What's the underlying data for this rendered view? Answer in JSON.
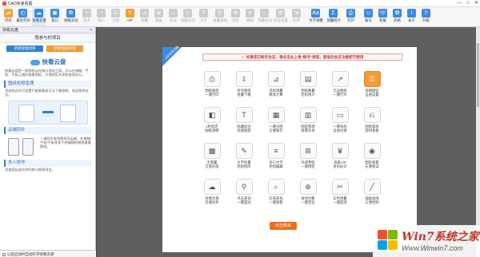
{
  "window": {
    "title": "CAD快速看图",
    "controls": [
      "—",
      "□",
      "✕"
    ]
  },
  "toolbar": {
    "tools": [
      {
        "label": "打开",
        "icon": "open-folder-icon",
        "color": "#e9a23b",
        "glyph": "📂",
        "state": "normal"
      },
      {
        "label": "最近打开",
        "icon": "recent-files-icon",
        "color": "#3c8be0",
        "glyph": "◴",
        "state": "normal"
      },
      {
        "label": "快看云盘",
        "icon": "cloud-icon",
        "color": "#3c8be0",
        "glyph": "☁",
        "state": "active"
      },
      {
        "label": "窗口",
        "icon": "window-icon",
        "color": "#3c8be0",
        "glyph": "▣",
        "state": "normal"
      },
      {
        "label": "图纸对比",
        "icon": "compare-icon",
        "color": "#3c8be0",
        "glyph": "⧉",
        "state": "normal"
      },
      {
        "label": "放大",
        "icon": "zoom-in-icon",
        "color": "#999",
        "glyph": "+",
        "state": "disabled"
      },
      {
        "label": "缩小",
        "icon": "zoom-out-icon",
        "color": "#999",
        "glyph": "−",
        "state": "disabled"
      },
      {
        "label": "全图",
        "icon": "fit-icon",
        "color": "#999",
        "glyph": "⊡",
        "state": "disabled"
      },
      {
        "label": "VIP",
        "icon": "vip-icon",
        "color": "#f0a030",
        "glyph": "V",
        "state": "normal"
      },
      {
        "label": "测量",
        "icon": "measure-icon",
        "color": "#999",
        "glyph": "⊿",
        "state": "disabled"
      },
      {
        "label": "图层",
        "icon": "layer-icon",
        "color": "#999",
        "glyph": "≣",
        "state": "disabled"
      },
      {
        "label": "标注",
        "icon": "dimension-icon",
        "color": "#999",
        "glyph": "↔",
        "state": "disabled"
      },
      {
        "label": "图纸识别",
        "icon": "recognize-icon",
        "color": "#999",
        "glyph": "⌕",
        "state": "disabled"
      },
      {
        "label": "文字",
        "icon": "text-icon",
        "color": "#999",
        "glyph": "T",
        "state": "disabled"
      },
      {
        "label": "批量查找",
        "icon": "batch-find-icon",
        "color": "#999",
        "glyph": "⚲",
        "state": "disabled"
      },
      {
        "label": "坐标",
        "icon": "coordinate-icon",
        "color": "#999",
        "glyph": "✛",
        "state": "disabled"
      },
      {
        "label": "删除",
        "icon": "delete-icon",
        "color": "#999",
        "glyph": "✕",
        "state": "disabled"
      },
      {
        "label": "隐藏标注",
        "icon": "hide-icon",
        "color": "#999",
        "glyph": "◌",
        "state": "disabled"
      },
      {
        "label": "标注设置",
        "icon": "settings-icon",
        "color": "#999",
        "glyph": "⚙",
        "state": "disabled"
      },
      {
        "label": "比例",
        "icon": "scale-icon",
        "color": "#999",
        "glyph": "⇲",
        "state": "disabled"
      },
      {
        "label": "文字调整",
        "icon": "text-adjust-icon",
        "color": "#3c8be0",
        "glyph": "Aa",
        "state": "normal"
      },
      {
        "label": "测量统计",
        "icon": "statistics-icon",
        "color": "#3c8be0",
        "glyph": "Σ",
        "state": "normal"
      },
      {
        "label": "打印",
        "icon": "print-icon",
        "color": "#3c8be0",
        "glyph": "⎙",
        "state": "normal"
      },
      {
        "label": "账号",
        "icon": "account-icon",
        "color": "#3c8be0",
        "glyph": "☺",
        "state": "normal"
      },
      {
        "label": "客服",
        "icon": "service-icon",
        "color": "#3c8be0",
        "glyph": "☏",
        "state": "normal"
      },
      {
        "label": "风格",
        "icon": "style-icon",
        "color": "#3c8be0",
        "glyph": "✿",
        "state": "normal"
      },
      {
        "label": "关于",
        "icon": "about-icon",
        "color": "#3c8be0",
        "glyph": "i",
        "state": "normal"
      },
      {
        "label": "升级",
        "icon": "upgrade-icon",
        "color": "#3c8be0",
        "glyph": "⇧",
        "state": "normal"
      }
    ]
  },
  "sidebar": {
    "header": "快看云盘",
    "close": "✕",
    "subtitle": "我参与的项目",
    "btn_new_team": "新建管理项目",
    "btn_new_project": "新建图纸项目",
    "promo_title": "快看云盘",
    "promo_desc": "快看云盘是一款图纸云存储与协同工具，可以在电脑、手机、平板上随时查看图纸，方便团队共享和协同办公。",
    "section1": "图纸权限管理",
    "section1_desc": "添加成员时可设置只能查看或可以下载图纸，保证图纸安全。",
    "section2": "云端同步",
    "section2_desc": "一键同步本地图纸到云端，在电脑/手机/平板等多个终端随时随地查看图纸。",
    "section3": "多人协作",
    "section3_desc": "添加团队成员共同参与图纸项目。",
    "footer": "以后启动时自动打开快看云盘"
  },
  "canvas": {
    "tag": "VIP专享功能",
    "warning_icon": "⚠",
    "warning": "如果您已购买会员，请点击右上角\"账号\"按钮，登录后会员功能即可使用",
    "buy_button": "点击购买",
    "features": [
      {
        "label": "图纸推荐\n一键打印",
        "glyph": "⎙",
        "highlight": false
      },
      {
        "label": "所有图纸\n批量下载",
        "glyph": "⇩",
        "highlight": false
      },
      {
        "label": "连续测量\n精准计算",
        "glyph": "⊿",
        "highlight": false
      },
      {
        "label": "图纸数量\n轻松统计",
        "glyph": "▤",
        "highlight": false
      },
      {
        "label": "无压图纸\n一键打开",
        "glyph": "↗",
        "highlight": false
      },
      {
        "label": "快捷键位\n自由设置",
        "glyph": "⚿",
        "highlight": true
      },
      {
        "label": "1秒搞定\n图纸清晰",
        "glyph": "◧",
        "highlight": false
      },
      {
        "label": "隐藏标注\n快速搜索",
        "glyph": "T",
        "highlight": false
      },
      {
        "label": "一键分图\n方便保存",
        "glyph": "▦",
        "highlight": false
      },
      {
        "label": "图层管理\n按需开关",
        "glyph": "▥",
        "highlight": false
      },
      {
        "label": "一键布局\n自由切换",
        "glyph": "▭",
        "highlight": false
      },
      {
        "label": "图纸版本\n随时查看",
        "glyph": "⎌",
        "highlight": false
      },
      {
        "label": "无限量\n全面开放",
        "glyph": "▩",
        "highlight": false
      },
      {
        "label": "文字批量\n轻松修改",
        "glyph": "✎",
        "highlight": false
      },
      {
        "label": "多行文字\n轻松编辑",
        "glyph": "≡",
        "highlight": false
      },
      {
        "label": "外部参照\n一键绑定",
        "glyph": "⊞",
        "highlight": false
      },
      {
        "label": "高级VIP\n身份标识",
        "glyph": "♛",
        "highlight": false
      },
      {
        "label": "图形查看\n方便阅读",
        "glyph": "◉",
        "highlight": false
      },
      {
        "label": "快看云盘\n云端同步",
        "glyph": "☁",
        "highlight": false
      },
      {
        "label": "点击查询\n一键鉴别",
        "glyph": "⚲",
        "highlight": false
      },
      {
        "label": "区域查找\n一键查看",
        "glyph": "⌕",
        "highlight": false
      },
      {
        "label": "查找对象\n一键定位",
        "glyph": "⊕",
        "highlight": false
      },
      {
        "label": "实时测量\n一键取消",
        "glyph": "✂",
        "highlight": false
      },
      {
        "label": "辅助画线\n方便绘制",
        "glyph": "╱",
        "highlight": false
      }
    ]
  },
  "watermark": {
    "brand": "Win7系统之家",
    "url": "Www.Winwin7.com"
  },
  "colors": {
    "accent_blue": "#2f7fd6",
    "accent_orange": "#ef6c1a",
    "warning_red": "#c0392b"
  }
}
